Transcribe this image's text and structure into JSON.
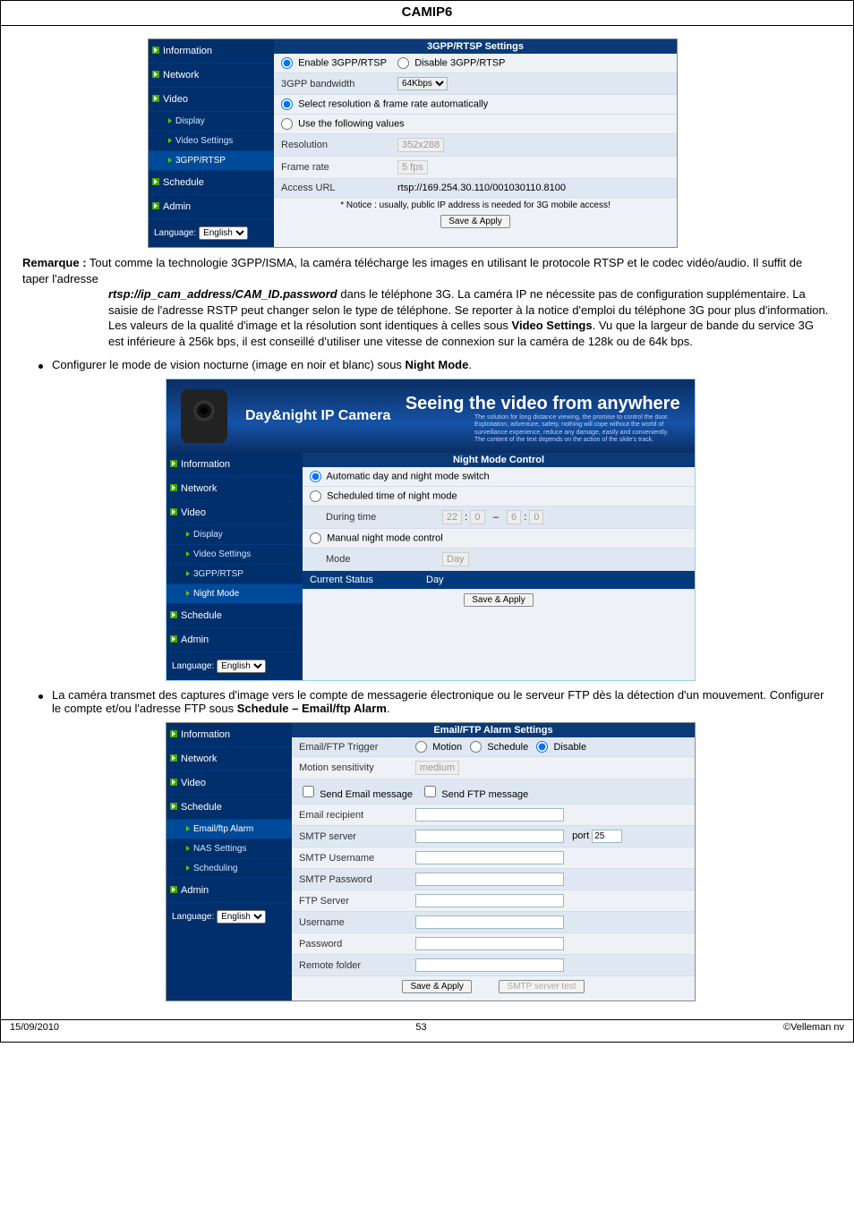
{
  "header": {
    "title": "CAMIP6"
  },
  "footer": {
    "date": "15/09/2010",
    "page": "53",
    "copyright": "©Velleman nv"
  },
  "remarque": {
    "label": "Remarque :",
    "p1": "Tout comme la technologie 3GPP/ISMA, la caméra télécharge les images en utilisant le protocole RTSP et le codec vidéo/audio. Il suffit de taper l'adresse",
    "p2_strong": "rtsp://ip_cam_address/CAM_ID.password",
    "p2_rest": " dans le téléphone 3G. La caméra IP ne nécessite pas de configuration supplémentaire. La saisie de l'adresse RSTP peut changer selon le type de téléphone. Se reporter à la notice d'emploi du téléphone 3G pour plus d'information. Les valeurs de la qualité d'image et la résolution sont identiques à celles sous ",
    "p2_bold": "Video Settings",
    "p2_tail": ". Vu que la largeur de bande du service 3G est inférieure à 256k bps, il est conseillé d'utiliser une vitesse de connexion sur la caméra de 128k ou de 64k bps."
  },
  "bullet1": {
    "pre": "Configurer le mode de vision nocturne (image en noir et blanc) sous ",
    "bold": "Night Mode",
    "post": "."
  },
  "bullet2": {
    "pre": "La caméra transmet des captures d'image vers le compte de messagerie électronique ou le serveur FTP dès la détection d'un mouvement. Configurer le compte et/ou l'adresse FTP sous ",
    "bold": "Schedule – Email/ftp Alarm",
    "post": "."
  },
  "nav": {
    "information": "Information",
    "network": "Network",
    "video": "Video",
    "display": "Display",
    "video_settings": "Video Settings",
    "tgpp": "3GPP/RTSP",
    "night_mode": "Night Mode",
    "schedule": "Schedule",
    "email_ftp": "Email/ftp Alarm",
    "nas": "NAS Settings",
    "scheduling": "Scheduling",
    "admin": "Admin",
    "language_label": "Language:",
    "language_value": "English"
  },
  "panel1": {
    "title": "3GPP/RTSP Settings",
    "enable": "Enable 3GPP/RTSP",
    "disable": "Disable 3GPP/RTSP",
    "bw_label": "3GPP bandwidth",
    "bw_value": "64Kbps",
    "auto": "Select resolution & frame rate automatically",
    "usefollow": "Use the following values",
    "resolution_label": "Resolution",
    "resolution_value": "352x288",
    "framerate_label": "Frame rate",
    "framerate_value": "5 fps",
    "access_label": "Access URL",
    "access_value": "rtsp://169.254.30.110/001030110.8100",
    "notice": "* Notice : usually, public IP address is needed for 3G mobile access!",
    "save": "Save & Apply"
  },
  "panel2": {
    "hero_brand": "Day&night IP Camera",
    "hero_tag": "Seeing the video from anywhere",
    "hero_fine": "The solution for long distance viewing, the promise to control the door. Exploitation, adventure, safety, nothing will cope without the world of surveillance experience, reduce any damage, easily and conveniently. The content of the text depends on the action of the slide's track.",
    "title": "Night Mode Control",
    "auto": "Automatic day and night mode switch",
    "sched": "Scheduled time of night mode",
    "during": "During time",
    "h1": "22",
    "m1": "0",
    "sep": "–",
    "h2": "6",
    "m2": "0",
    "manual": "Manual night mode control",
    "mode_label": "Mode",
    "mode_value": "Day",
    "status_label": "Current Status",
    "status_value": "Day",
    "save": "Save & Apply"
  },
  "panel3": {
    "title": "Email/FTP Alarm Settings",
    "trigger_label": "Email/FTP Trigger",
    "motion": "Motion",
    "schedule": "Schedule",
    "disable": "Disable",
    "sens_label": "Motion sensitivity",
    "sens_value": "medium",
    "send_email": "Send Email message",
    "send_ftp": "Send FTP message",
    "recipient": "Email recipient",
    "smtp_server": "SMTP server",
    "port_label": "port",
    "port_value": "25",
    "smtp_user": "SMTP Username",
    "smtp_pass": "SMTP Password",
    "ftp_server": "FTP Server",
    "username": "Username",
    "password": "Password",
    "remote": "Remote folder",
    "save": "Save & Apply",
    "test": "SMTP server test"
  }
}
